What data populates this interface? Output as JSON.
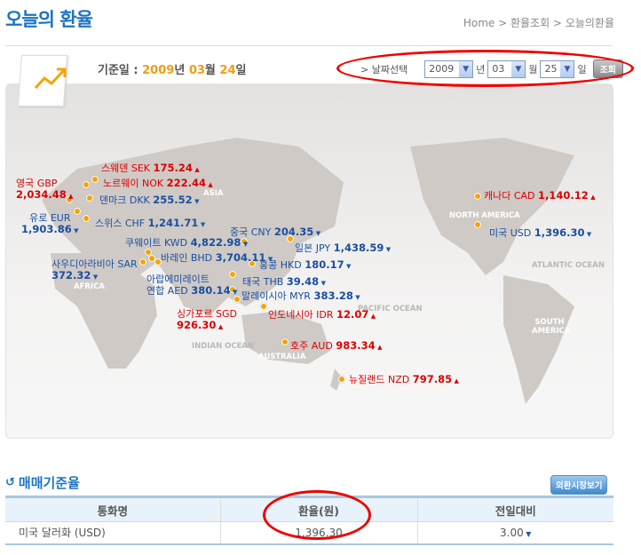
{
  "header": {
    "title": "오늘의 환율",
    "breadcrumb": "Home > 환율조회 > 오늘의환율"
  },
  "base_date": {
    "label": "기준일 : ",
    "year": "2009",
    "year_unit": "년 ",
    "month": "03",
    "month_unit": "월 ",
    "day": "24",
    "day_unit": "일"
  },
  "date_select": {
    "label": "> 날짜선택",
    "year": "2009",
    "year_unit": "년",
    "month": "03",
    "month_unit": "월",
    "day": "25",
    "day_unit": "일",
    "search_label": "조회"
  },
  "regions": {
    "asia": "ASIA",
    "north_america": "NORTH AMERICA",
    "africa": "AFRICA",
    "atlantic": "ATLANTIC OCEAN",
    "pacific": "PACIFIC OCEAN",
    "indian": "INDIAN OCEAN",
    "australia": "AUSTRALIA",
    "south_america": "SOUTH AMERICA"
  },
  "currencies": {
    "sek": {
      "name": "스웨덴 SEK",
      "value": "175.24",
      "dir": "up"
    },
    "nok": {
      "name": "노르웨이 NOK",
      "value": "222.44",
      "dir": "up"
    },
    "gbp": {
      "name": "영국 GBP",
      "value": "2,034.48",
      "dir": "up"
    },
    "dkk": {
      "name": "덴마크 DKK",
      "value": "255.52",
      "dir": "down"
    },
    "eur": {
      "name": "유로 EUR",
      "value": "1,903.86",
      "dir": "down"
    },
    "chf": {
      "name": "스위스 CHF",
      "value": "1,241.71",
      "dir": "down"
    },
    "cny": {
      "name": "중국 CNY",
      "value": "204.35",
      "dir": "down"
    },
    "kwd": {
      "name": "쿠웨이트 KWD",
      "value": "4,822.98",
      "dir": "down"
    },
    "jpy": {
      "name": "일본 JPY",
      "value": "1,438.59",
      "dir": "down"
    },
    "bhd": {
      "name": "바레인 BHD",
      "value": "3,704.11",
      "dir": "down"
    },
    "sar": {
      "name": "사우디아라비아 SAR",
      "value": "372.32",
      "dir": "down"
    },
    "hkd": {
      "name": "홍콩 HKD",
      "value": "180.17",
      "dir": "down"
    },
    "aed": {
      "name1": "아랍에미레이트",
      "name": "연합 AED",
      "value": "380.14",
      "dir": "down"
    },
    "thb": {
      "name": "태국 THB",
      "value": "39.48",
      "dir": "down"
    },
    "myr": {
      "name": "말레이시아 MYR",
      "value": "383.28",
      "dir": "down"
    },
    "sgd": {
      "name": "싱가포르 SGD",
      "value": "926.30",
      "dir": "up"
    },
    "idr": {
      "name": "인도네시아 IDR",
      "value": "12.07",
      "dir": "up"
    },
    "aud": {
      "name": "호주 AUD",
      "value": "983.34",
      "dir": "up"
    },
    "nzd": {
      "name": "뉴질랜드 NZD",
      "value": "797.85",
      "dir": "up"
    },
    "cad": {
      "name": "캐나다 CAD",
      "value": "1,140.12",
      "dir": "up"
    },
    "usd": {
      "name": "미국 USD",
      "value": "1,396.30",
      "dir": "down"
    }
  },
  "section": {
    "title": "매매기준율",
    "fx_button": "외환시장보기"
  },
  "table": {
    "headers": [
      "통화명",
      "환율(원)",
      "전일대비"
    ],
    "rows": [
      {
        "currency": "미국 달러화 (USD)",
        "rate": "1,396.30",
        "change": "3.00"
      }
    ]
  },
  "colors": {
    "accent": "#1a73c4",
    "up": "#dd0000",
    "down": "#1a4fa0",
    "highlight": "#f39c12",
    "annotation": "#ee0000"
  }
}
